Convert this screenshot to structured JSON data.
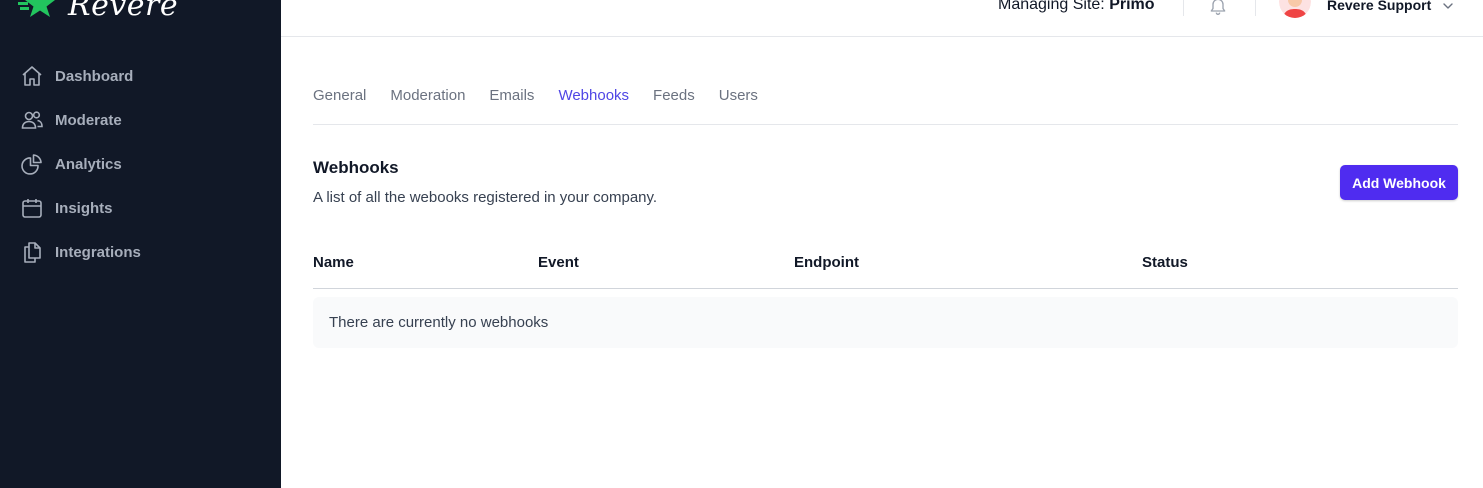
{
  "app": {
    "brand_name": "Revere",
    "colors": {
      "sidebar_bg": "#111827",
      "brand_green": "#22c55e",
      "accent": "#4f46e5",
      "button_bg": "#4f2cf0"
    }
  },
  "sidebar": {
    "items": [
      {
        "label": "Dashboard",
        "icon": "home-icon"
      },
      {
        "label": "Moderate",
        "icon": "users-icon"
      },
      {
        "label": "Analytics",
        "icon": "pie-chart-icon"
      },
      {
        "label": "Insights",
        "icon": "calendar-icon"
      },
      {
        "label": "Integrations",
        "icon": "documents-icon"
      }
    ]
  },
  "header": {
    "managing_label": "Managing Site:",
    "managing_site": "Primo",
    "user_name": "Revere Support",
    "icons": [
      "bell-icon",
      "avatar",
      "chevron-down-icon"
    ]
  },
  "tabs": [
    {
      "label": "General",
      "active": false
    },
    {
      "label": "Moderation",
      "active": false
    },
    {
      "label": "Emails",
      "active": false
    },
    {
      "label": "Webhooks",
      "active": true
    },
    {
      "label": "Feeds",
      "active": false
    },
    {
      "label": "Users",
      "active": false
    }
  ],
  "webhooks": {
    "title": "Webhooks",
    "description": "A list of all the webooks registered in your company.",
    "add_button": "Add Webhook",
    "columns": [
      "Name",
      "Event",
      "Endpoint",
      "Status"
    ],
    "empty_message": "There are currently no webhooks"
  }
}
